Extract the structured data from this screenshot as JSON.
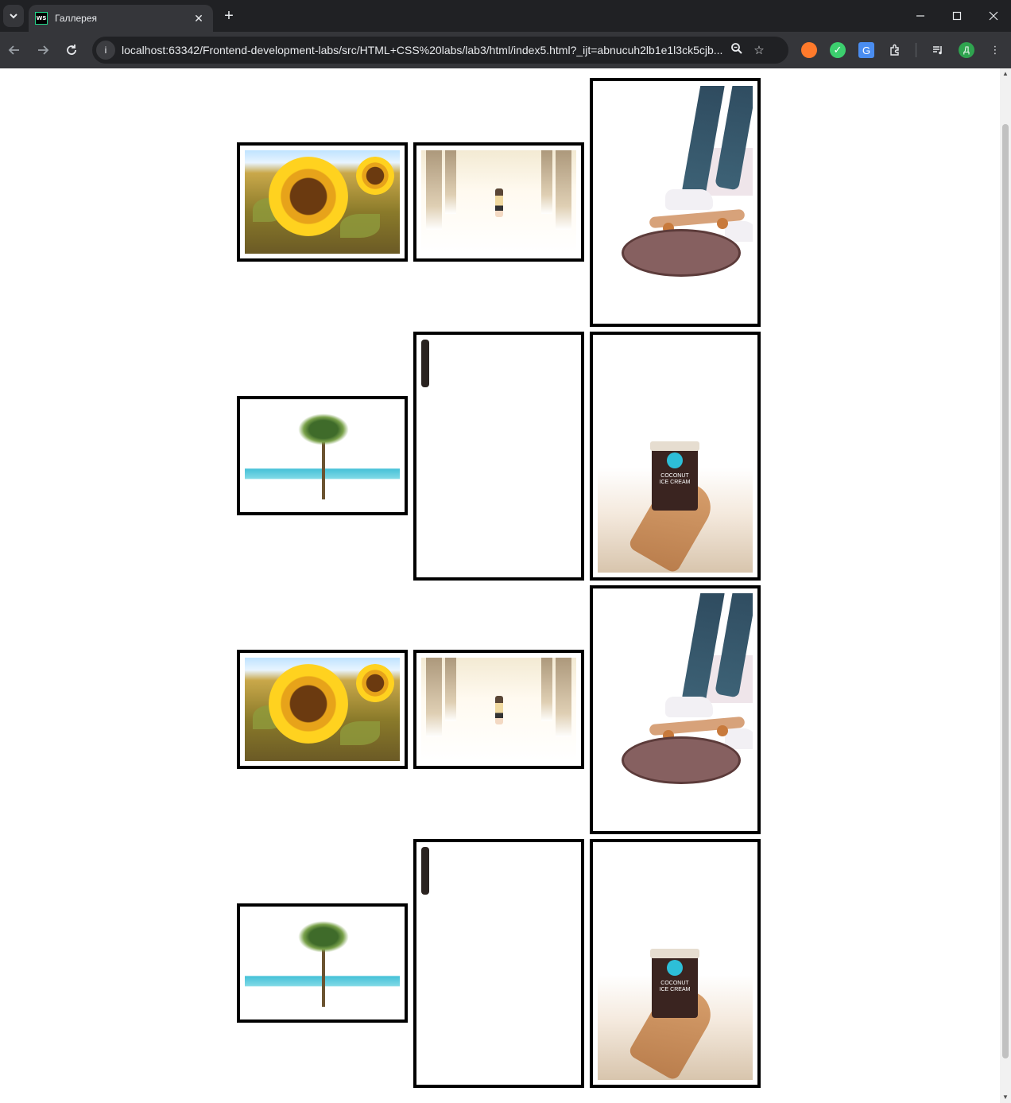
{
  "browser": {
    "tab_title": "Галлерея",
    "favicon_text": "WS",
    "url": "localhost:63342/Frontend-development-labs/src/HTML+CSS%20labs/lab3/html/index5.html?_ijt=abnucuh2lb1e1l3ck5cjb...",
    "profile_initial": "Д",
    "icons": {
      "tab_menu": "chevron-down-icon",
      "tab_close": "close-icon",
      "new_tab": "plus-icon",
      "minimize": "minimize-icon",
      "maximize": "maximize-icon",
      "close_window": "close-window-icon",
      "back": "back-arrow-icon",
      "forward": "forward-arrow-icon",
      "reload": "reload-icon",
      "site_info": "info-icon",
      "zoom": "zoom-icon",
      "bookmark": "star-icon",
      "extensions": "puzzle-icon",
      "media": "media-icon",
      "more": "kebab-menu-icon"
    }
  },
  "gallery": {
    "cup_label": "COCONUT ICE CREAM",
    "rows": [
      {
        "items": [
          {
            "type": "landscape",
            "subject": "sunflower"
          },
          {
            "type": "landscape",
            "subject": "pier"
          },
          {
            "type": "portrait",
            "subject": "skateboard"
          }
        ]
      },
      {
        "items": [
          {
            "type": "landscape",
            "subject": "palm"
          },
          {
            "type": "portrait",
            "subject": "surfer"
          },
          {
            "type": "portrait",
            "subject": "icecream"
          }
        ]
      },
      {
        "items": [
          {
            "type": "landscape",
            "subject": "sunflower"
          },
          {
            "type": "landscape",
            "subject": "pier"
          },
          {
            "type": "portrait",
            "subject": "skateboard"
          }
        ]
      },
      {
        "items": [
          {
            "type": "landscape",
            "subject": "palm"
          },
          {
            "type": "portrait",
            "subject": "surfer"
          },
          {
            "type": "portrait",
            "subject": "icecream"
          }
        ]
      }
    ]
  },
  "colors": {
    "chrome_dark": "#202124",
    "chrome_toolbar": "#35363a",
    "frame_border": "#000000",
    "page_bg": "#ffffff"
  }
}
